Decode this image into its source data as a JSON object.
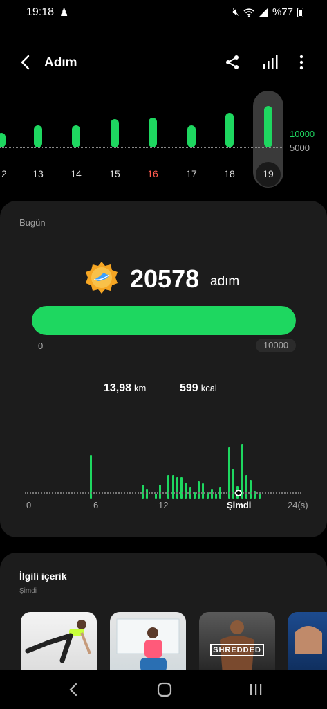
{
  "status": {
    "time": "19:18",
    "battery": "%77"
  },
  "header": {
    "title": "Adım"
  },
  "days": {
    "items": [
      {
        "label": "12",
        "fraction": 0.3,
        "red": false
      },
      {
        "label": "13",
        "fraction": 0.45,
        "red": false
      },
      {
        "label": "14",
        "fraction": 0.45,
        "red": false
      },
      {
        "label": "15",
        "fraction": 0.58,
        "red": false
      },
      {
        "label": "16",
        "fraction": 0.62,
        "red": false
      },
      {
        "label": "17",
        "fraction": 0.46,
        "red": false
      },
      {
        "label": "18",
        "fraction": 0.72,
        "red": false
      },
      {
        "label": "19",
        "fraction": 0.85,
        "red": false
      }
    ],
    "goal_high": "10000",
    "goal_low": "5000"
  },
  "today": {
    "label": "Bugün",
    "steps": "20578",
    "unit": "adım",
    "progress": 1.0,
    "min": "0",
    "max": "10000",
    "distance": "13,98",
    "distance_unit": "km",
    "calories": "599",
    "calories_unit": "kcal"
  },
  "hourly": {
    "values": [
      0,
      0,
      0,
      0,
      0,
      0,
      0,
      0,
      0,
      0,
      0,
      0,
      0,
      0,
      0,
      0.7,
      0,
      0,
      0,
      0,
      0,
      0,
      0,
      0,
      0,
      0,
      0,
      0.22,
      0.16,
      0,
      0.08,
      0.22,
      0,
      0.38,
      0.38,
      0.35,
      0.35,
      0.26,
      0.18,
      0.1,
      0.28,
      0.24,
      0.1,
      0.16,
      0.08,
      0.18,
      0,
      0.82,
      0.48,
      0.2,
      0.88,
      0.38,
      0.3,
      0.12,
      0.08,
      0,
      0,
      0,
      0,
      0,
      0,
      0,
      0,
      0
    ],
    "labels": [
      "0",
      "6",
      "12",
      "Şimdi",
      "24(s)"
    ]
  },
  "related": {
    "title": "İlgili içerik",
    "subtitle": "Şimdi",
    "thumb3_text": "SHREDDED"
  }
}
